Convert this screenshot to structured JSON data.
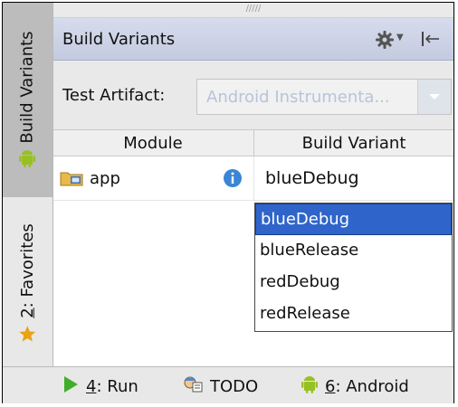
{
  "side_tabs": {
    "build_variants": "Build Variants",
    "favorites_mnemonic": "2",
    "favorites_rest": ": Favorites"
  },
  "panel": {
    "title": "Build Variants",
    "grip": "/////"
  },
  "test_artifact": {
    "label": "Test Artifact:",
    "value": "Android Instrumenta..."
  },
  "table": {
    "headers": {
      "module": "Module",
      "build_variant": "Build Variant"
    },
    "row": {
      "module": "app",
      "build_variant": "blueDebug"
    }
  },
  "dropdown": {
    "options": [
      "blueDebug",
      "blueRelease",
      "redDebug",
      "redRelease"
    ],
    "selected_index": 0
  },
  "bottom_bar": {
    "run_mnemonic": "4",
    "run_rest": ": Run",
    "todo": "TODO",
    "android_mnemonic": "6",
    "android_rest": ": Android"
  },
  "colors": {
    "title_bar": "#c9d0e4",
    "selection": "#2f65ca",
    "android_green": "#97c024",
    "run_green": "#3fae2a",
    "star": "#e8a317"
  },
  "icons": [
    "android-icon",
    "star-icon",
    "gear-icon",
    "hide-panel-icon",
    "folder-module-icon",
    "info-icon",
    "run-icon",
    "todo-icon",
    "chevron-down-icon"
  ]
}
